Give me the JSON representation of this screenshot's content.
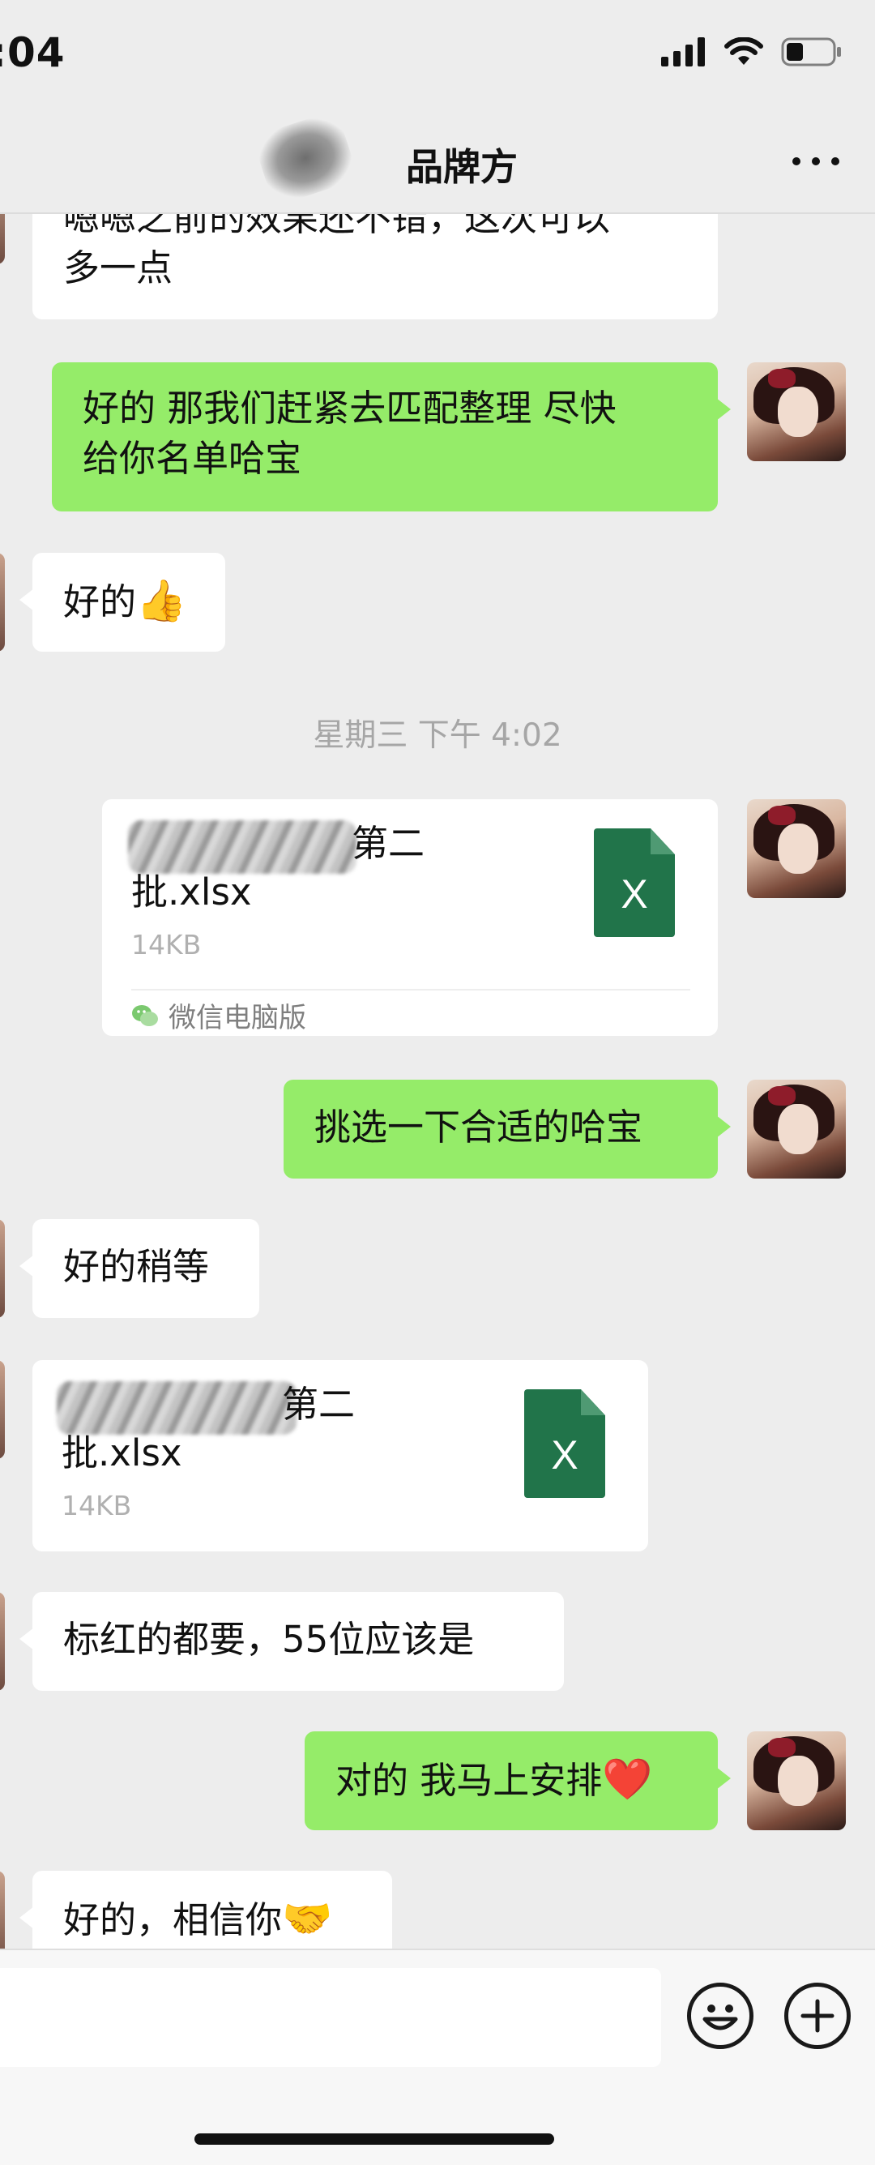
{
  "status_bar": {
    "time": ":04"
  },
  "header": {
    "title": "品牌方"
  },
  "messages": {
    "m1": {
      "line1": "嗯嗯之前的效果还不错，这次可以",
      "line2": "多一点"
    },
    "m2": {
      "line1": "好的 那我们赶紧去匹配整理 尽快",
      "line2": "给你名单哈宝"
    },
    "m3": {
      "text": "好的",
      "emoji": "👍"
    },
    "timestamp": "星期三 下午 4:02",
    "file1": {
      "name_tail": "第二",
      "name_line2": "批.xlsx",
      "size": "14KB",
      "source": "微信电脑版",
      "icon_letter": "X"
    },
    "m4": {
      "text": "挑选一下合适的哈宝"
    },
    "m5": {
      "text": "好的稍等"
    },
    "file2": {
      "name_tail": "第二",
      "name_line2": "批.xlsx",
      "size": "14KB",
      "icon_letter": "X"
    },
    "m6": {
      "text": "标红的都要，55位应该是"
    },
    "m7": {
      "text": "对的 我马上安排",
      "emoji": "❤️"
    },
    "m8": {
      "text": "好的，相信你",
      "emoji": "🤝"
    }
  },
  "icons": {
    "more": "more-icon",
    "emoji": "emoji-icon",
    "add": "add-icon",
    "signal": "signal-icon",
    "wifi": "wifi-icon",
    "battery": "battery-icon"
  },
  "colors": {
    "sent_bubble": "#95ec69",
    "received_bubble": "#ffffff",
    "background": "#ededed",
    "excel_green": "#21744a"
  }
}
